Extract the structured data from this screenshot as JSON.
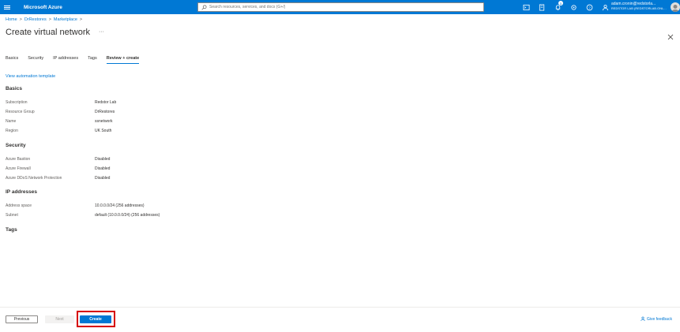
{
  "app": {
    "brand": "Microsoft Azure",
    "search_placeholder": "Search resources, services, and docs (G+/)",
    "notification_count": "1",
    "account_email": "adam.cronin@redstorla...",
    "account_org": "REDSTOR LAB (REDSTORLAB.ONL..."
  },
  "breadcrumb": {
    "items": [
      "Home",
      "DrRestores",
      "Marketplace"
    ],
    "separator": ">"
  },
  "page": {
    "title": "Create virtual network",
    "ellipsis": "···"
  },
  "tabs": [
    {
      "label": "Basics"
    },
    {
      "label": "Security"
    },
    {
      "label": "IP addresses"
    },
    {
      "label": "Tags"
    },
    {
      "label": "Review + create"
    }
  ],
  "active_tab": "Review + create",
  "automation_link": "View automation template",
  "sections": {
    "basics": {
      "title": "Basics",
      "rows": [
        {
          "label": "Subscription",
          "value": "Redstor Lab"
        },
        {
          "label": "Resource Group",
          "value": "DrRestores"
        },
        {
          "label": "Name",
          "value": "ssnetwork"
        },
        {
          "label": "Region",
          "value": "UK South"
        }
      ]
    },
    "security": {
      "title": "Security",
      "rows": [
        {
          "label": "Azure Bastion",
          "value": "Disabled"
        },
        {
          "label": "Azure Firewall",
          "value": "Disabled"
        },
        {
          "label": "Azure DDoS Network Protection",
          "value": "Disabled"
        }
      ]
    },
    "ip": {
      "title": "IP addresses",
      "rows": [
        {
          "label": "Address space",
          "value": "10.0.0.0/24 (256 addresses)"
        },
        {
          "label": "Subnet",
          "value": "default (10.0.0.0/24) (256 addresses)"
        }
      ]
    },
    "tags": {
      "title": "Tags"
    }
  },
  "footer": {
    "previous_label": "Previous",
    "next_label": "Next",
    "create_label": "Create",
    "feedback_label": "Give feedback"
  },
  "colors": {
    "accent": "#0078d4",
    "highlight": "#d60000"
  }
}
